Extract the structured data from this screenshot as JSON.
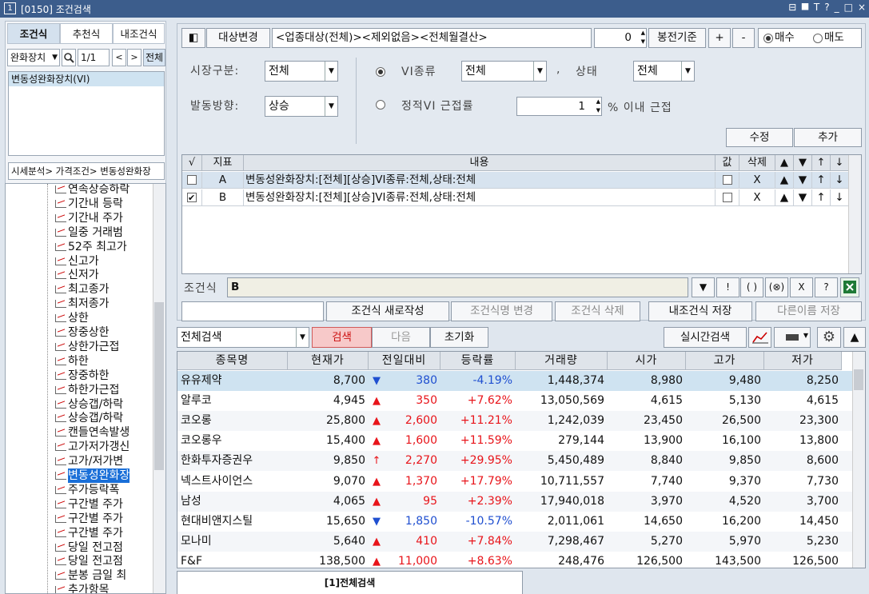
{
  "window": {
    "num": "1",
    "title": "[0150] 조건검색",
    "controls": [
      "⊟",
      "⯀",
      "T",
      "?",
      "_",
      "□",
      "×"
    ]
  },
  "left": {
    "tabs": [
      "조건식",
      "추천식",
      "내조건식"
    ],
    "category_select": "완화장치",
    "page": "1/1",
    "prev": "<",
    "next": ">",
    "all_btn": "전체",
    "list_items": [
      "변동성완화장치(VI)"
    ],
    "path": "시세분석> 가격조건> 변동성완화장",
    "tree": [
      "연속상승하락",
      "기간내 등락",
      "기간내 주가",
      "일중 거래범",
      "52주 최고가",
      "신고가",
      "신저가",
      "최고종가",
      "최저종가",
      "상한",
      "장중상한",
      "상한가근접",
      "하한",
      "장중하한",
      "하한가근접",
      "상승갭/하락",
      "상승갭/하락",
      "캔들연속발생",
      "고가저가갱신",
      "고가/저가변",
      "변동성완화장",
      "주가등락폭",
      "구간별 주가",
      "구간별 주가",
      "구간별 주가",
      "당일 전고점",
      "당일 전고점",
      "분봉 금일 최",
      "추가항목"
    ],
    "tree_selected_index": 20
  },
  "toolbar": {
    "target_change": "대상변경",
    "target_text": "<업종대상(전체)><제외없음><전체월결산>",
    "count_value": "0",
    "basis": "봉전기준",
    "plus": "+",
    "minus": "-",
    "buy": "매수",
    "sell": "매도"
  },
  "filters": {
    "market_label": "시장구분:",
    "market_value": "전체",
    "direction_label": "발동방향:",
    "direction_value": "상승",
    "vi_type_label": "VI종류",
    "vi_type_value": "전체",
    "comma": ",",
    "status_label": "상태",
    "status_value": "전체",
    "static_label": "정적VI 근접률",
    "static_value": "1",
    "static_suffix": "% 이내 근접",
    "edit_btn": "수정",
    "add_btn": "추가"
  },
  "cond_grid": {
    "headers": [
      "√",
      "지표",
      "내용",
      "값",
      "삭제",
      "▲",
      "▼",
      "↑",
      "↓"
    ],
    "rows": [
      {
        "checked": false,
        "idx": "A",
        "content": "변동성완화장치:[전체][상승]VI종류:전체,상태:전체",
        "del": "X",
        "up2": "▲",
        "down2": "▼",
        "up": "↑",
        "down": "↓"
      },
      {
        "checked": true,
        "idx": "B",
        "content": "변동성완화장치:[전체][상승]VI종류:전체,상태:전체",
        "del": "X",
        "up2": "▲",
        "down2": "▼",
        "up": "↑",
        "down": "↓"
      }
    ]
  },
  "formula": {
    "label": "조건식",
    "value": "B",
    "ops": [
      "▼",
      "!",
      "( )",
      "(⊗)",
      "X",
      "?"
    ]
  },
  "actions": {
    "new": "조건식 새로작성",
    "rename": "조건식명 변경",
    "delete": "조건식 삭제",
    "save": "내조건식 저장",
    "save_as": "다른이름 저장"
  },
  "search_bar": {
    "scope": "전체검색",
    "search": "검색",
    "next": "다음",
    "reset": "초기화",
    "realtime": "실시간검색"
  },
  "results": {
    "headers": [
      "종목명",
      "현재가",
      "전일대비",
      "등락률",
      "거래량",
      "시가",
      "고가",
      "저가"
    ],
    "rows": [
      {
        "name": "유유제약",
        "price": "8,700",
        "sym": "▼",
        "change": "380",
        "rate": "-4.19%",
        "volume": "1,448,374",
        "open": "8,980",
        "high": "9,480",
        "low": "8,250",
        "dir": "down"
      },
      {
        "name": "알루코",
        "price": "4,945",
        "sym": "▲",
        "change": "350",
        "rate": "+7.62%",
        "volume": "13,050,569",
        "open": "4,615",
        "high": "5,130",
        "low": "4,615",
        "dir": "up"
      },
      {
        "name": "코오롱",
        "price": "25,800",
        "sym": "▲",
        "change": "2,600",
        "rate": "+11.21%",
        "volume": "1,242,039",
        "open": "23,450",
        "high": "26,500",
        "low": "23,300",
        "dir": "up"
      },
      {
        "name": "코오롱우",
        "price": "15,400",
        "sym": "▲",
        "change": "1,600",
        "rate": "+11.59%",
        "volume": "279,144",
        "open": "13,900",
        "high": "16,100",
        "low": "13,800",
        "dir": "up"
      },
      {
        "name": "한화투자증권우",
        "price": "9,850",
        "sym": "↑",
        "change": "2,270",
        "rate": "+29.95%",
        "volume": "5,450,489",
        "open": "8,840",
        "high": "9,850",
        "low": "8,600",
        "dir": "up"
      },
      {
        "name": "넥스트사이언스",
        "price": "9,070",
        "sym": "▲",
        "change": "1,370",
        "rate": "+17.79%",
        "volume": "10,711,557",
        "open": "7,740",
        "high": "9,370",
        "low": "7,730",
        "dir": "up"
      },
      {
        "name": "남성",
        "price": "4,065",
        "sym": "▲",
        "change": "95",
        "rate": "+2.39%",
        "volume": "17,940,018",
        "open": "3,970",
        "high": "4,520",
        "low": "3,700",
        "dir": "up"
      },
      {
        "name": "현대비앤지스틸",
        "price": "15,650",
        "sym": "▼",
        "change": "1,850",
        "rate": "-10.57%",
        "volume": "2,011,061",
        "open": "14,650",
        "high": "16,200",
        "low": "14,450",
        "dir": "down"
      },
      {
        "name": "모나미",
        "price": "5,640",
        "sym": "▲",
        "change": "410",
        "rate": "+7.84%",
        "volume": "7,298,467",
        "open": "5,270",
        "high": "5,970",
        "low": "5,230",
        "dir": "up"
      },
      {
        "name": "F&F",
        "price": "138,500",
        "sym": "▲",
        "change": "11,000",
        "rate": "+8.63%",
        "volume": "248,476",
        "open": "126,500",
        "high": "143,500",
        "low": "126,500",
        "dir": "up"
      }
    ]
  },
  "bottom_tab": "[1]전체검색",
  "colors": {
    "up": "#e8141a",
    "down": "#1f4fd0",
    "titlebar": "#3c5d8c",
    "selected_row": "#cfe3f1"
  }
}
